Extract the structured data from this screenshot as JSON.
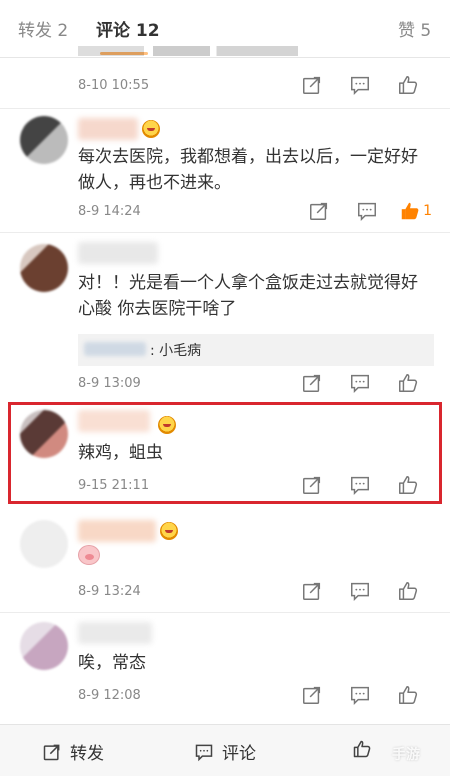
{
  "tabs": {
    "repost": "转发 2",
    "comments": "评论 12",
    "likes": "赞 5"
  },
  "colors": {
    "accent": "#ff8200",
    "highlight_border": "#d9262e"
  },
  "comments": [
    {
      "time": "8-10 10:55"
    },
    {
      "text": "每次去医院，我都想着，出去以后，一定好好做人，再也不进来。",
      "time": "8-9 14:24",
      "like_count": "1"
    },
    {
      "text": "对！！光是看一个人拿个盒饭走过去就觉得好心酸 你去医院干啥了",
      "reply": ": 小毛病",
      "time": "8-9 13:09"
    },
    {
      "text": "辣鸡，蛆虫",
      "time": "9-15 21:11"
    },
    {
      "emoji": "pig-face-icon",
      "time": "8-9 13:24"
    },
    {
      "text": "唉，常态",
      "time": "8-9 12:08"
    }
  ],
  "icons": {
    "repost": "share-icon",
    "comment": "comment-icon",
    "like": "thumbs-up-icon"
  },
  "bottombar": {
    "repost": "转发",
    "comment": "评论",
    "watermark": "手游"
  }
}
